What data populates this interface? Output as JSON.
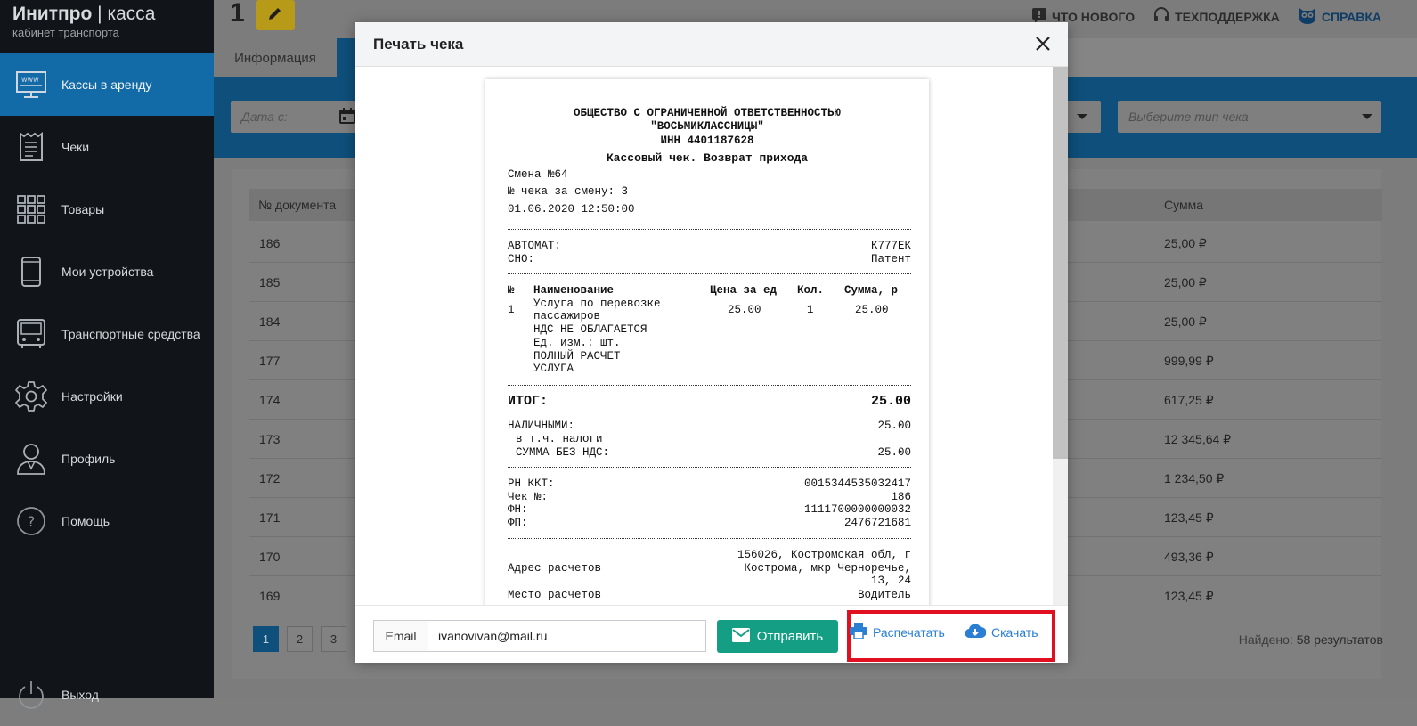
{
  "brand": {
    "name": "Инитпро",
    "separator": "|",
    "product": "касса",
    "subtitle": "кабинет транспорта"
  },
  "sidebar": {
    "items": [
      {
        "label": "Кассы в аренду",
        "icon": "www-monitor-icon",
        "active": true
      },
      {
        "label": "Чеки",
        "icon": "receipt-icon"
      },
      {
        "label": "Товары",
        "icon": "grid-icon"
      },
      {
        "label": "Мои устройства",
        "icon": "phone-icon"
      },
      {
        "label": "Транспортные средства",
        "icon": "bus-icon"
      },
      {
        "label": "Настройки",
        "icon": "gear-icon"
      },
      {
        "label": "Профиль",
        "icon": "user-icon"
      },
      {
        "label": "Помощь",
        "icon": "help-icon"
      }
    ],
    "exit_label": "Выход"
  },
  "header": {
    "number": "1",
    "links": {
      "news": "ЧТО НОВОГО",
      "support": "ТЕХПОДДЕРЖКА",
      "help": "СПРАВКА"
    }
  },
  "tabs": {
    "info": "Информация"
  },
  "filters": {
    "date_from_placeholder": "Дата с:",
    "check_type_placeholder": "Выберите тип чека"
  },
  "table": {
    "headers": {
      "doc": "№ документа",
      "sum": "Сумма"
    },
    "rows": [
      {
        "doc": "186",
        "sum": "25,00 ₽"
      },
      {
        "doc": "185",
        "sum": "25,00 ₽"
      },
      {
        "doc": "184",
        "sum": "25,00 ₽"
      },
      {
        "doc": "177",
        "sum": "999,99 ₽"
      },
      {
        "doc": "174",
        "sum": "617,25 ₽"
      },
      {
        "doc": "173",
        "sum": "12 345,64 ₽"
      },
      {
        "doc": "172",
        "sum": "1 234,50 ₽"
      },
      {
        "doc": "171",
        "sum": "123,45 ₽"
      },
      {
        "doc": "170",
        "sum": "493,36 ₽"
      },
      {
        "doc": "169",
        "sum": "123,45 ₽"
      }
    ]
  },
  "pagination": {
    "pages": [
      "1",
      "2",
      "3"
    ],
    "current": "1"
  },
  "found": {
    "label": "Найдено:",
    "value": "58 результатов"
  },
  "modal": {
    "title": "Печать чека",
    "receipt": {
      "org_line1": "ОБЩЕСТВО С ОГРАНИЧЕННОЙ ОТВЕТСТВЕННОСТЬЮ",
      "org_line2": "\"ВОСЬМИКЛАССНИЦЫ\"",
      "inn": "ИНН 4401187628",
      "doc_type": "Кассовый чек. Возврат прихода",
      "shift": "Смена №64",
      "check_in_shift": "№ чека за смену: 3",
      "datetime": "01.06.2020 12:50:00",
      "automat_label": "АВТОМАТ:",
      "automat_value": "К777ЕК",
      "sno_label": "СНО:",
      "sno_value": "Патент",
      "columns": {
        "num": "№",
        "name": "Наименование",
        "price": "Цена за ед",
        "qty": "Кол.",
        "sum": "Сумма, р"
      },
      "item": {
        "num": "1",
        "name_lines": [
          "Услуга по перевозке",
          "пассажиров",
          "НДС НЕ ОБЛАГАЕТСЯ",
          "Ед. изм.: шт.",
          "ПОЛНЫЙ РАСЧЕТ",
          "УСЛУГА"
        ],
        "price": "25.00",
        "qty": "1",
        "sum": "25.00"
      },
      "total_label": "ИТОГ:",
      "total_value": "25.00",
      "cash_label": "НАЛИЧНЫМИ:",
      "cash_value": "25.00",
      "taxes_label": "в т.ч. налоги",
      "no_vat_label": "СУММА БЕЗ НДС:",
      "no_vat_value": "25.00",
      "rn_label": "РН ККТ:",
      "rn_value": "0015344535032417",
      "check_no_label": "Чек №:",
      "check_no_value": "186",
      "fn_label": "ФН:",
      "fn_value": "1111700000000032",
      "fp_label": "ФП:",
      "fp_value": "2476721681",
      "address_label": "Адрес расчетов",
      "address_lines": [
        "156026, Костромская обл, г",
        "Кострома, мкр Черноречье,",
        "13, 24"
      ],
      "place_label": "Место расчетов",
      "place_value": "Водитель"
    },
    "email_label": "Email",
    "email_value": "ivanovivan@mail.ru",
    "send_label": "Отправить",
    "print_label": "Распечатать",
    "download_label": "Скачать"
  },
  "colors": {
    "accent": "#126aa6",
    "send": "#149e84",
    "highlight": "#e01020",
    "link": "#2a7fd4"
  }
}
